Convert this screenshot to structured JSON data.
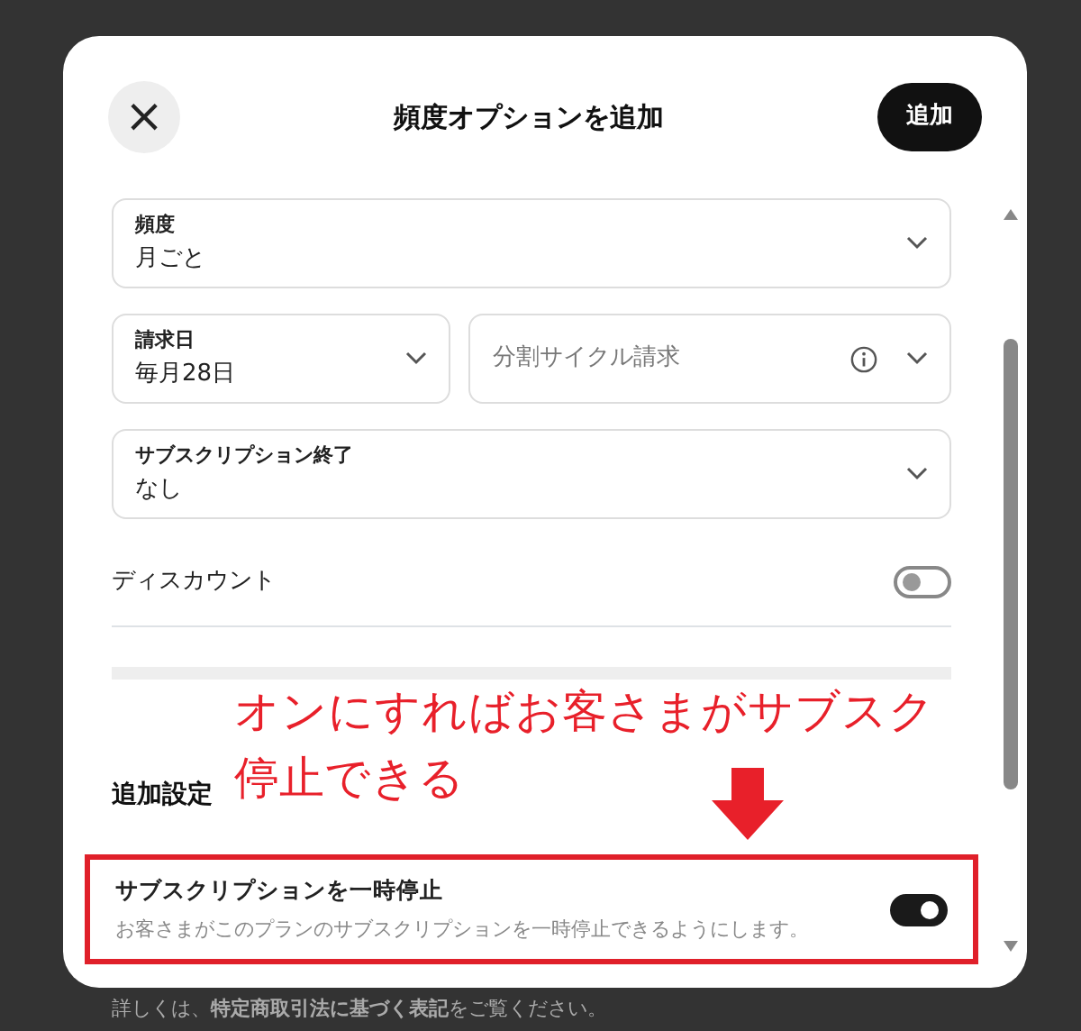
{
  "background": {
    "footer_note": "詳しくは、**特定商取引法に基づく表記**をご覧ください。"
  },
  "dialog": {
    "title": "頻度オプションを追加",
    "close_icon": "×",
    "add_button": "追加"
  },
  "field_rows": [
    [
      {
        "label": "頻度",
        "value": "月ごと"
      }
    ],
    [
      {
        "label": "請求日",
        "value": "毎月28日"
      },
      {
        "placeholder": "分割サイクル請求",
        "info": true
      }
    ],
    [
      {
        "label": "サブスクリプション終了",
        "value": "なし"
      }
    ]
  ],
  "discount": {
    "label": "ディスカウント",
    "on": false
  },
  "additional_settings": {
    "heading": "追加設定",
    "pause": {
      "title": "サブスクリプションを一時停止",
      "description": "お客さまがこのプランのサブスクリプションを一時停止できるようにします。",
      "on": true,
      "highlighted": true
    }
  },
  "annotation": {
    "lines": [
      "オンにすればお客さまがサブスク",
      "停止できる"
    ]
  }
}
